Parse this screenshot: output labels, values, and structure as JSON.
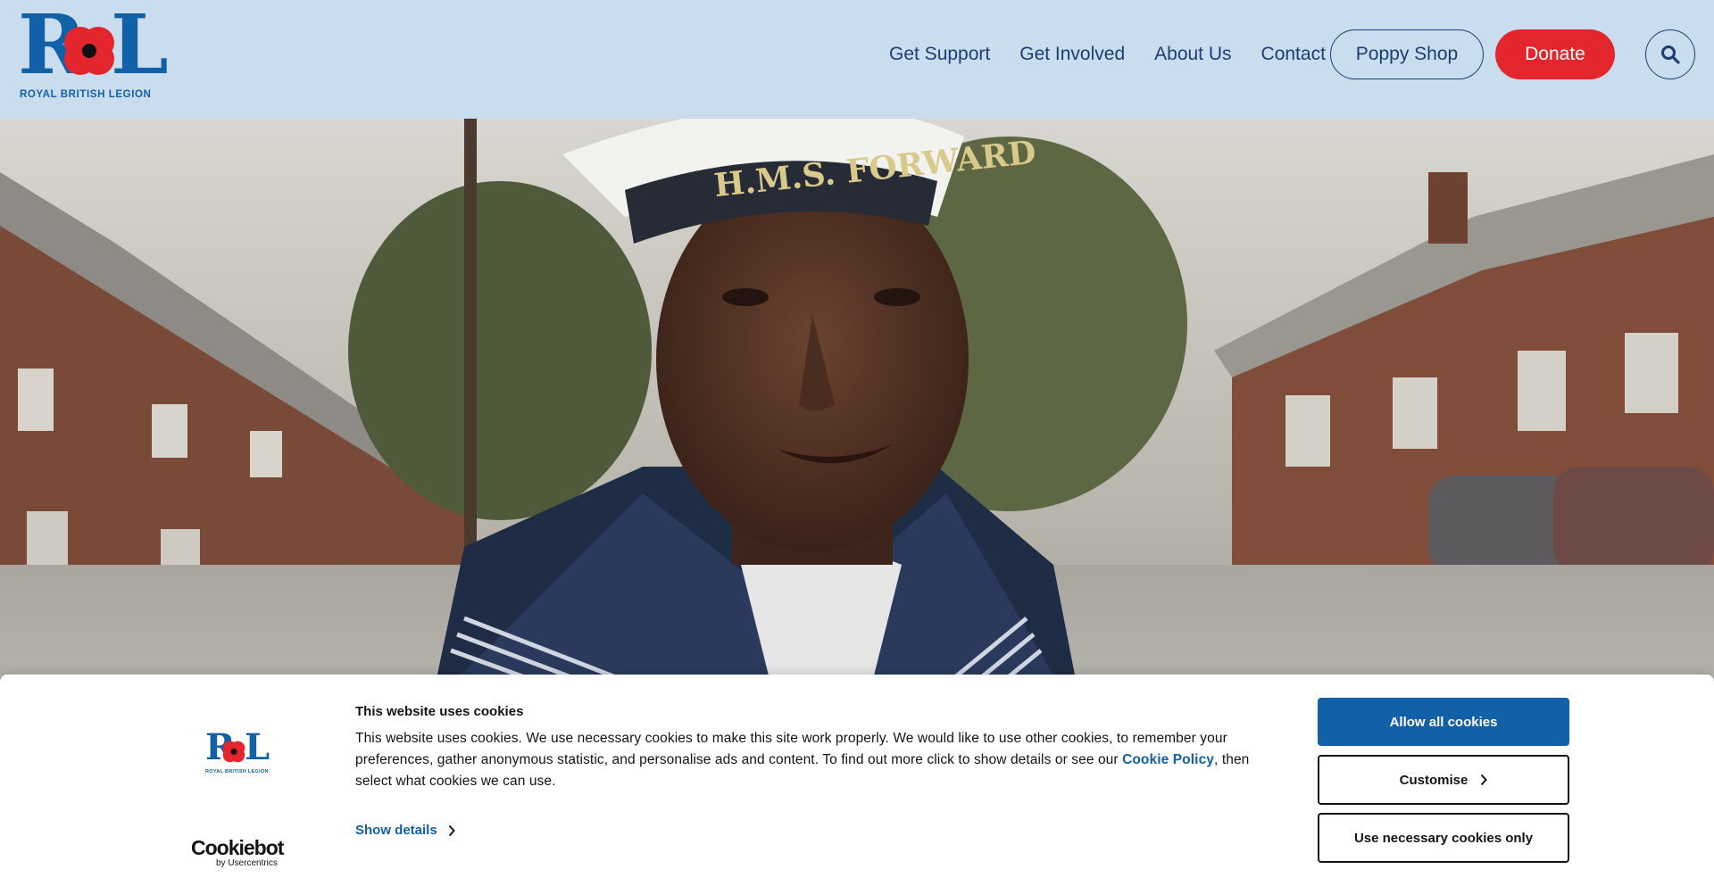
{
  "header": {
    "logo_text": "ROYAL BRITISH LEGION",
    "logo_letters": [
      "R",
      "L"
    ],
    "nav": [
      {
        "label": "Get Support"
      },
      {
        "label": "Get Involved"
      },
      {
        "label": "About Us"
      },
      {
        "label": "Contact"
      }
    ],
    "poppy_shop_label": "Poppy Shop",
    "donate_label": "Donate",
    "search_icon": "search-icon"
  },
  "hero": {
    "cap_text": "H.M.S. FORWARD",
    "image": "sailor-portrait-photo"
  },
  "cookie_banner": {
    "title": "This website uses cookies",
    "body_before_link": "This website uses cookies. We use necessary cookies to make this site work properly. We would like to use other cookies, to remember your preferences, gather anonymous statistic, and personalise ads and content. To find out more click to show details or see our ",
    "link_label": "Cookie Policy",
    "body_after_link": ", then select what cookies we can use.",
    "show_details_label": "Show details",
    "allow_all_label": "Allow all cookies",
    "customise_label": "Customise",
    "necessary_only_label": "Use necessary cookies only",
    "provider_name": "Cookiebot",
    "provider_by": "by Usercentrics",
    "logo_text": "ROYAL BRITISH LEGION"
  },
  "colors": {
    "header_bg": "#c9ddee",
    "brand_blue": "#1160a8",
    "nav_text": "#1d3d73",
    "donate_red": "#e3262d"
  }
}
